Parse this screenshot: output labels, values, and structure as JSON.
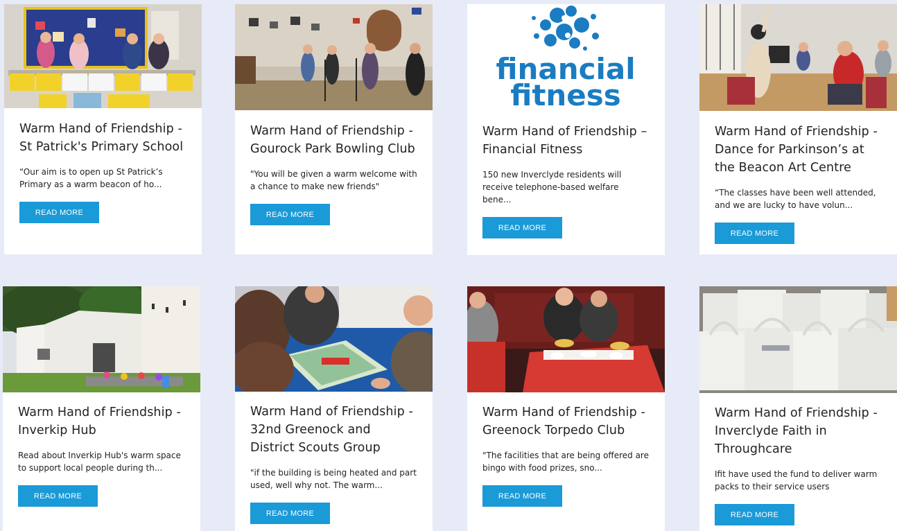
{
  "read_more_label": "READ MORE",
  "colors": {
    "page_background": "#e7ebf8",
    "card_background": "#ffffff",
    "button_background": "#1a9ad7",
    "logo_blue": "#1a7cc1"
  },
  "cards": [
    {
      "title": "Warm Hand of Friendship - St Patrick's Primary School",
      "excerpt": "“Our aim is to open up St Patrick’s Primary as a warm beacon of ho...",
      "image": "photo-children-with-food-parcels"
    },
    {
      "title": "Warm Hand of Friendship - Gourock Park Bowling Club",
      "excerpt": "\"You will be given a warm welcome with a chance to make new friends\"",
      "image": "photo-band-playing-in-club"
    },
    {
      "title": "Warm Hand of Friendship – Financial Fitness",
      "excerpt": "150 new Inverclyde residents will receive telephone-based welfare bene...",
      "image": "financial-fitness-logo",
      "logo_text_line1": "financial",
      "logo_text_line2": "fitness"
    },
    {
      "title": "Warm Hand of Friendship - Dance for Parkinson’s at the Beacon Art Centre",
      "excerpt": "“The classes have been well attended, and we are lucky to have volun...",
      "image": "photo-seated-dance-class"
    },
    {
      "title": "Warm Hand of Friendship - Inverkip Hub",
      "excerpt": "Read about Inverkip Hub's warm space to support local people during th...",
      "image": "photo-white-community-building"
    },
    {
      "title": "Warm Hand of Friendship - 32nd Greenock and District Scouts Group",
      "excerpt": "\"if the building is being heated and part used, well why not. The warm...",
      "image": "photo-scouts-playing-board-game"
    },
    {
      "title": "Warm Hand of Friendship - Greenock Torpedo Club",
      "excerpt": "\"The facilities that are being offered are bingo with food prizes, sno...",
      "image": "photo-people-at-red-table"
    },
    {
      "title": "Warm Hand of Friendship - Inverclyde Faith in Throughcare",
      "excerpt": "Ifit have used the fund to deliver warm packs to their service users",
      "image": "photo-stack-of-white-bags"
    }
  ]
}
